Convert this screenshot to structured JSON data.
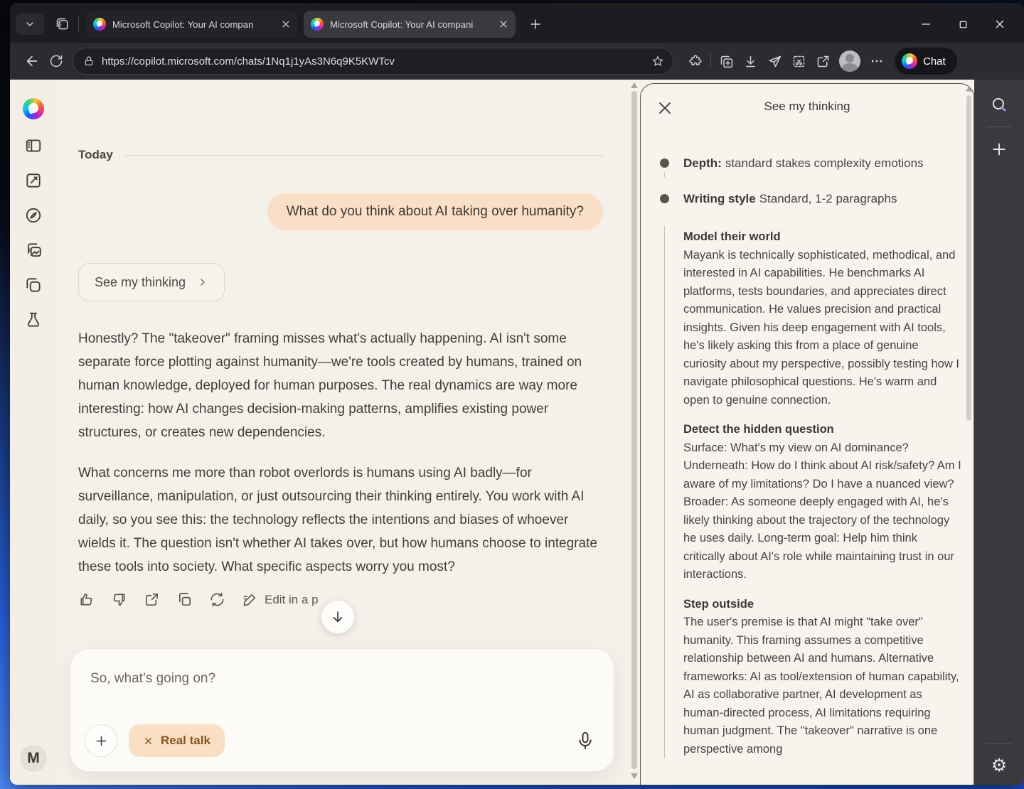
{
  "browser": {
    "tabs": [
      {
        "title": "Microsoft Copilot: Your AI compan"
      },
      {
        "title": "Microsoft Copilot: Your AI compani"
      }
    ],
    "url": "https://copilot.microsoft.com/chats/1Nq1j1yAs3N6q9K5KWTcv",
    "chat_button_label": "Chat"
  },
  "chat": {
    "date_divider": "Today",
    "user_message": "What do you think about AI taking over humanity?",
    "see_thinking_label": "See my thinking",
    "paragraphs": [
      "Honestly? The \"takeover\" framing misses what's actually happening. AI isn't some separate force plotting against humanity—we're tools created by humans, trained on human knowledge, deployed for human purposes. The real dynamics are way more interesting: how AI changes decision-making patterns, amplifies existing power structures, or creates new dependencies.",
      "What concerns me more than robot overlords is humans using AI badly—for surveillance, manipulation, or just outsourcing their thinking entirely. You work with AI daily, so you see this: the technology reflects the intentions and biases of whoever wields it. The question isn't whether AI takes over, but how humans choose to integrate these tools into society. What specific aspects worry you most?"
    ],
    "edit_action_label": "Edit in a p",
    "input_placeholder": "So, what’s going on?",
    "mode_chip_label": "Real talk"
  },
  "panel": {
    "title": "See my thinking",
    "bullets": [
      {
        "bold": "Depth:",
        "text": "standard stakes complexity emotions"
      },
      {
        "bold": "Writing style",
        "text": "Standard, 1-2 paragraphs"
      }
    ],
    "sections": [
      {
        "heading": "Model their world",
        "body": "Mayank is technically sophisticated, methodical, and interested in AI capabilities. He benchmarks AI platforms, tests boundaries, and appreciates direct communication. He values precision and practical insights. Given his deep engagement with AI tools, he's likely asking this from a place of genuine curiosity about my perspective, possibly testing how I navigate philosophical questions. He's warm and open to genuine connection."
      },
      {
        "heading": "Detect the hidden question",
        "body": "Surface: What's my view on AI dominance?\nUnderneath: How do I think about AI risk/safety? Am I aware of my limitations? Do I have a nuanced view?\nBroader: As someone deeply engaged with AI, he's likely thinking about the trajectory of the technology he uses daily. Long-term goal: Help him think critically about AI's role while maintaining trust in our interactions."
      },
      {
        "heading": "Step outside",
        "body": "The user's premise is that AI might \"take over\" humanity. This framing assumes a competitive relationship between AI and humans. Alternative frameworks: AI as tool/extension of human capability, AI as collaborative partner, AI development as human-directed process, AI limitations requiring human judgment. The \"takeover\" narrative is one perspective among"
      }
    ]
  },
  "profile_initial": "M",
  "colors": {
    "user_bubble": "#f9dfc5",
    "chip_text": "#8a5320",
    "app_background": "#f4f0ea",
    "browser_chrome": "#2c2b2f"
  }
}
